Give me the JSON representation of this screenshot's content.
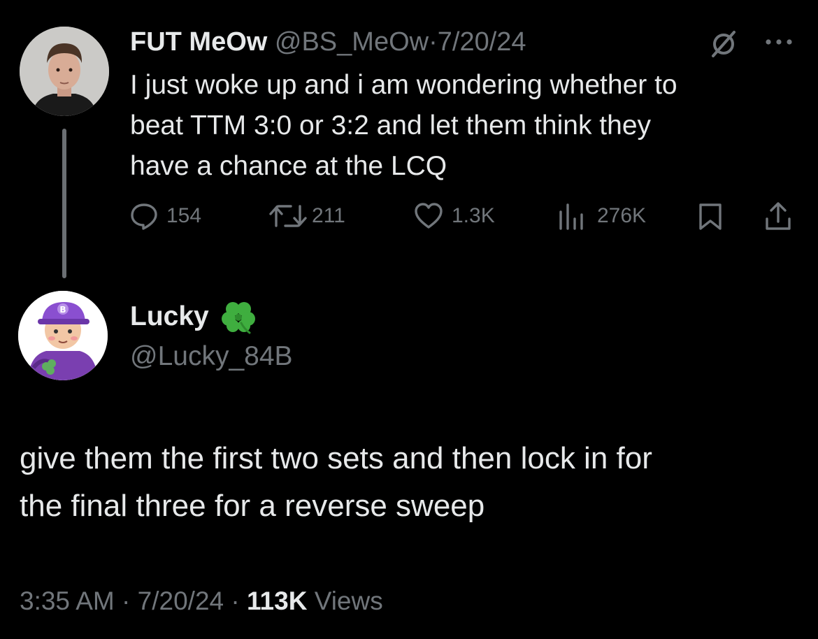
{
  "colors": {
    "background": "#000000",
    "text": "#e7e9ea",
    "muted": "#71767b",
    "thread_line": "#6b6f73",
    "clover": "#3fae3f"
  },
  "parent_tweet": {
    "display_name": "FUT MeOw",
    "handle": "@BS_MeOw",
    "separator": "·",
    "date": "7/20/24",
    "text_lines": [
      "I just woke up and i am wondering whether to",
      "beat TTM 3:0 or 3:2 and let them think they",
      "have a chance at the LCQ"
    ],
    "replies": "154",
    "reposts": "211",
    "likes": "1.3K",
    "views": "276K",
    "icons": [
      "grok-slash-icon",
      "more-icon",
      "reply-icon",
      "repost-icon",
      "like-icon",
      "views-icon",
      "bookmark-icon",
      "share-icon"
    ]
  },
  "reply_tweet": {
    "display_name": "Lucky",
    "badge_emoji": "☘️",
    "handle": "@Lucky_84B",
    "text_lines": [
      "give them the first two sets and then lock in for",
      "the final three for a reverse sweep"
    ],
    "time": "3:35 AM",
    "sep1": "·",
    "date": "7/20/24",
    "sep2": "·",
    "views_count": "113K",
    "views_label": "Views"
  }
}
